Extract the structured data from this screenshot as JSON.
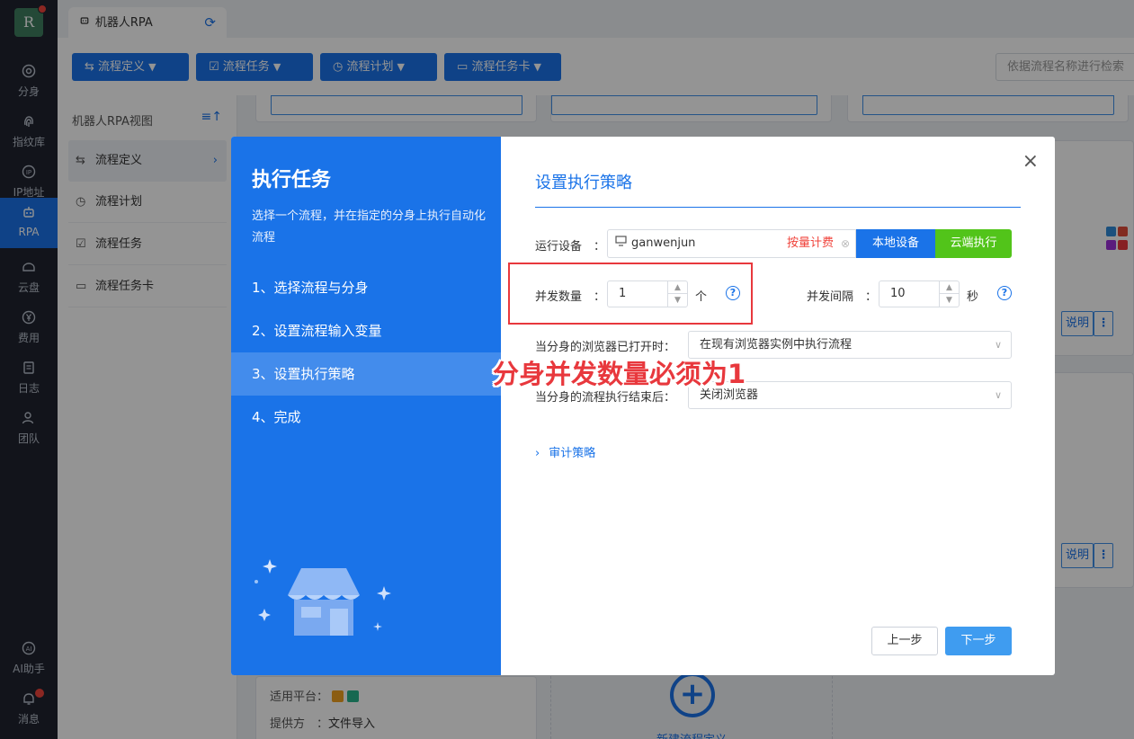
{
  "app": {
    "logo_letter": "R",
    "tab_title": "机器人RPA"
  },
  "rail": {
    "items": [
      {
        "label": "分身",
        "icon": "chrome-icon"
      },
      {
        "label": "指纹库",
        "icon": "fingerprint-icon"
      },
      {
        "label": "IP地址",
        "icon": "ip-icon"
      },
      {
        "label": "RPA",
        "icon": "robot-icon"
      },
      {
        "label": "云盘",
        "icon": "cloud-drive-icon"
      },
      {
        "label": "费用",
        "icon": "yen-icon"
      },
      {
        "label": "日志",
        "icon": "log-icon"
      },
      {
        "label": "团队",
        "icon": "team-icon"
      },
      {
        "label": "AI助手",
        "icon": "ai-icon"
      },
      {
        "label": "消息",
        "icon": "bell-icon"
      }
    ]
  },
  "toolbar": {
    "buttons": [
      "流程定义",
      "流程任务",
      "流程计划",
      "流程任务卡"
    ],
    "search_placeholder": "依据流程名称进行检索"
  },
  "sidenav": {
    "header": "机器人RPA视图",
    "items": [
      "流程定义",
      "流程计划",
      "流程任务",
      "流程任务卡"
    ]
  },
  "background": {
    "card_button": "说明",
    "platform_label": "适用平台",
    "provider_label": "提供方",
    "provider_value": "文件导入",
    "new_flow": "新建流程定义"
  },
  "modal": {
    "left": {
      "title": "执行任务",
      "desc": "选择一个流程，并在指定的分身上执行自动化流程",
      "steps": [
        "1、选择流程与分身",
        "2、设置流程输入变量",
        "3、设置执行策略",
        "4、完成"
      ]
    },
    "title": "设置执行策略",
    "device": {
      "label": "运行设备",
      "value": "ganwenjun",
      "fee": "按量计费",
      "local_btn": "本地设备",
      "cloud_btn": "云端执行"
    },
    "concurrency": {
      "label": "并发数量",
      "value": "1",
      "unit": "个"
    },
    "interval": {
      "label": "并发间隔",
      "value": "10",
      "unit": "秒"
    },
    "browser_open": {
      "label": "当分身的浏览器已打开时",
      "value": "在现有浏览器实例中执行流程"
    },
    "after_finish": {
      "label": "当分身的流程执行结束后",
      "value": "关闭浏览器"
    },
    "audit": "审计策略",
    "prev_btn": "上一步",
    "next_btn": "下一步"
  },
  "annotation": "分身并发数量必须为1",
  "colors": {
    "primary": "#1a73e8",
    "cloud": "#52c41a",
    "annotation": "#e8383d",
    "rail": "#1f2430"
  }
}
